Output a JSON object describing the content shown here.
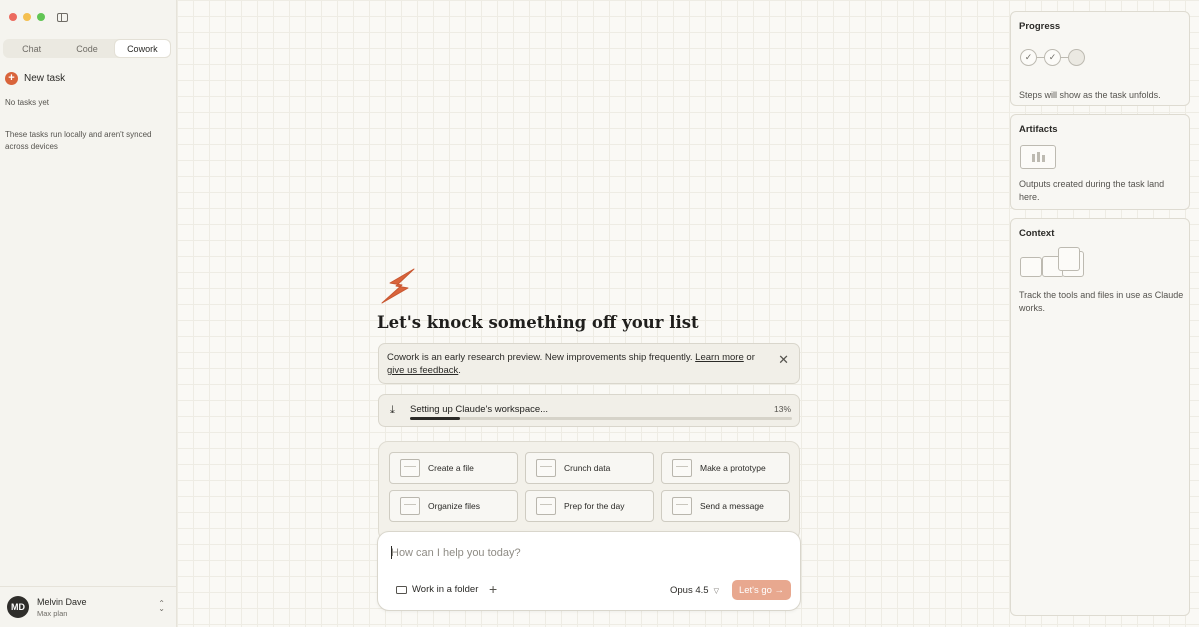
{
  "sidebar": {
    "mode_tabs": [
      {
        "label": "Chat"
      },
      {
        "label": "Code"
      },
      {
        "label": "Cowork"
      }
    ],
    "new_task_label": "New task",
    "empty_state": "No tasks yet",
    "local_note": "These tasks run locally and aren't synced across devices",
    "user": {
      "initials": "MD",
      "name": "Melvin Dave",
      "plan": "Max plan"
    }
  },
  "main": {
    "headline": "Let's knock something off your list",
    "notice": {
      "text_before": "Cowork is an early research preview. New improvements ship frequently. ",
      "learn_more": "Learn more",
      "or": " or ",
      "feedback": "give us feedback",
      "period": "."
    },
    "setup": {
      "label": "Setting up Claude's workspace...",
      "percent_text": "13%",
      "progress": 0.13
    },
    "actions": [
      {
        "label": "Create a file",
        "icon": "file-icon"
      },
      {
        "label": "Crunch data",
        "icon": "chart-icon"
      },
      {
        "label": "Make a prototype",
        "icon": "prototype-icon"
      },
      {
        "label": "Organize files",
        "icon": "folder-icon"
      },
      {
        "label": "Prep for the day",
        "icon": "calendar-icon"
      },
      {
        "label": "Send a message",
        "icon": "message-icon"
      }
    ],
    "composer": {
      "placeholder": "How can I help you today?",
      "folder_label": "Work in a folder",
      "model": "Opus 4.5",
      "submit_label": "Let's go →"
    }
  },
  "right_panels": {
    "progress": {
      "title": "Progress",
      "description": "Steps will show as the task unfolds."
    },
    "artifacts": {
      "title": "Artifacts",
      "description": "Outputs created during the task land here."
    },
    "context": {
      "title": "Context",
      "description": "Track the tools and files in use as Claude works."
    }
  },
  "colors": {
    "accent": "#d9643b",
    "go_button": "#e8a88f",
    "background": "#faf9f5"
  }
}
